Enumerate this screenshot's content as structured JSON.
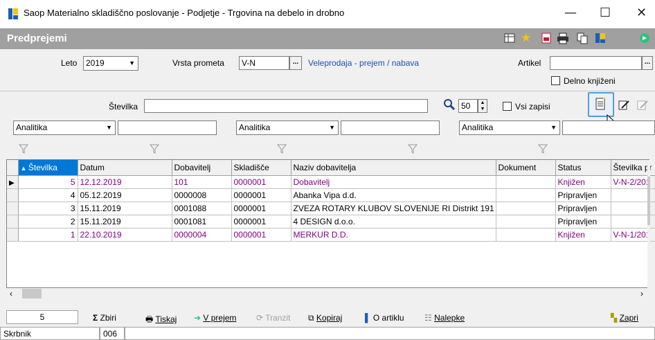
{
  "window": {
    "title": "Saop Materialno skladiščno poslovanje - Podjetje - Trgovina na debelo in drobno",
    "minimize": "—",
    "maximize": "☐",
    "close": "✕"
  },
  "section": {
    "title": "Predprejemi"
  },
  "filters": {
    "leto_label": "Leto",
    "leto_value": "2019",
    "vrsta_label": "Vrsta prometa",
    "vrsta_value": "V-N",
    "vrsta_desc": "Veleprodaja - prejem / nabava",
    "artikel_label": "Artikel",
    "artikel_value": "",
    "delno_label": "Delno knjiženi",
    "ellipsis": "..."
  },
  "search": {
    "stevilka_label": "Številka",
    "stevilka_value": "",
    "count": "50",
    "vsi_label": "Vsi zapisi"
  },
  "analitika": [
    {
      "value": "Analitika"
    },
    {
      "value": "Analitika"
    },
    {
      "value": "Analitika"
    }
  ],
  "grid": {
    "columns": [
      "Številka",
      "Datum",
      "Dobavitelj",
      "Skladišče",
      "Naziv dobavitelja",
      "Dokument",
      "Status",
      "Številka pr"
    ],
    "rows": [
      {
        "st": "5",
        "datum": "12.12.2019",
        "dob": "101",
        "skl": "0000001",
        "naziv": "Dobavitelj",
        "dok": "",
        "status": "Knjižen",
        "stpr": "V-N-2/201",
        "cur": true
      },
      {
        "st": "4",
        "datum": "05.12.2019",
        "dob": "0000008",
        "skl": "0000001",
        "naziv": "Abanka Vipa d.d.",
        "dok": "",
        "status": "Pripravljen",
        "stpr": "",
        "cur": false
      },
      {
        "st": "3",
        "datum": "15.11.2019",
        "dob": "0001088",
        "skl": "0000001",
        "naziv": "ZVEZA ROTARY KLUBOV SLOVENIJE RI Distrikt 191",
        "dok": "",
        "status": "Pripravljen",
        "stpr": "",
        "cur": false
      },
      {
        "st": "2",
        "datum": "15.11.2019",
        "dob": "0001081",
        "skl": "0000001",
        "naziv": "4 DESIGN d.o.o.",
        "dok": "",
        "status": "Pripravljen",
        "stpr": "",
        "cur": false
      },
      {
        "st": "1",
        "datum": "22.10.2019",
        "dob": "0000004",
        "skl": "0000001",
        "naziv": "MERKUR D.D.",
        "dok": "",
        "status": "Knjižen",
        "stpr": "V-N-1/201",
        "cur": false
      }
    ]
  },
  "bottom": {
    "count": "5",
    "zbiri": "Zbiri",
    "tiskaj": "Tiskaj",
    "vprejem": "V prejem",
    "tranzit": "Tranzit",
    "kopiraj": "Kopiraj",
    "oartiklu": "O artiklu",
    "nalepke": "Nalepke",
    "zapri": "Zapri"
  },
  "status": {
    "label": "Skrbnik",
    "value": "006"
  }
}
